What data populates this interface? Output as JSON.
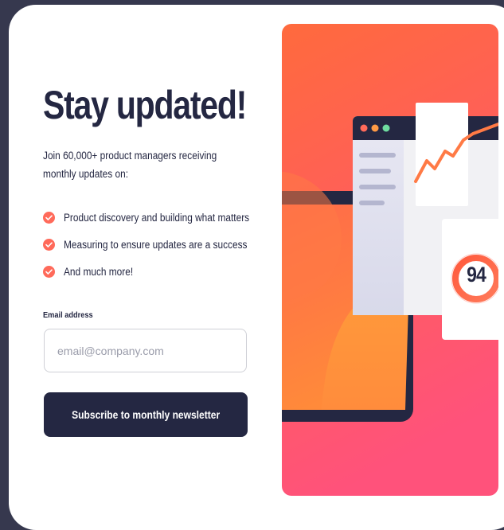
{
  "signup": {
    "title": "Stay updated!",
    "intro": "Join 60,000+ product managers receiving monthly updates on:",
    "features": [
      "Product discovery and building what matters",
      "Measuring to ensure updates are a success",
      "And much more!"
    ],
    "email_label": "Email address",
    "email_placeholder": "email@company.com",
    "email_value": "",
    "submit_label": "Subscribe to monthly newsletter"
  },
  "illustration": {
    "score": "94"
  },
  "colors": {
    "accent": "#ff6155",
    "navy": "#242742",
    "charcoal": "#36384e"
  }
}
